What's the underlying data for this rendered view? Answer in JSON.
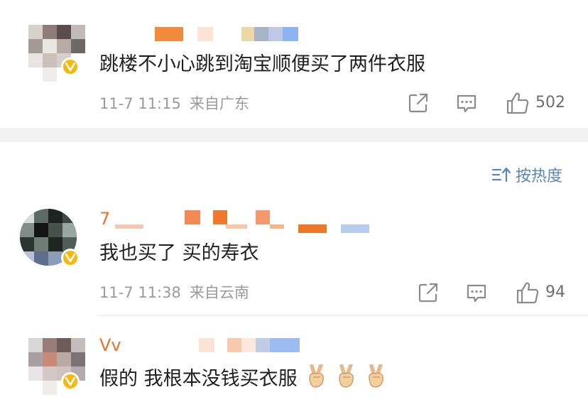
{
  "sort": {
    "label": "按热度",
    "icon": "sort-icon"
  },
  "comments": [
    {
      "username_visible": "",
      "text": "跳楼不小心跳到淘宝顺便买了两件衣服",
      "time": "11-7 11:15",
      "location": "来自广东",
      "like_count": "502"
    },
    {
      "username_visible": "7",
      "text": "我也买了 买的寿衣",
      "time": "11-7 11:38",
      "location": "来自云南",
      "like_count": "94"
    },
    {
      "username_visible": "Vv",
      "text": "假的 我根本没钱买衣服",
      "emoji_count": 3,
      "emoji_name": "victory-hand-emoji"
    }
  ],
  "colors": {
    "accent": "#e8732c",
    "badge": "#f6b80d",
    "sort": "#5a86b8",
    "meta": "#9a9a9a"
  }
}
